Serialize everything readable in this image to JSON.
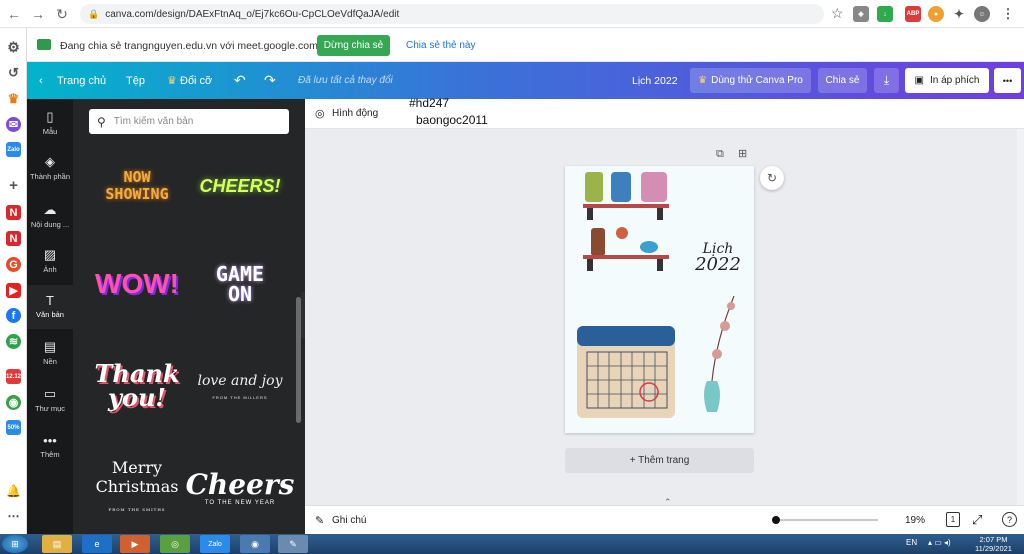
{
  "browser": {
    "url": "canva.com/design/DAExFtnAq_o/Ej7kc6Ou-CpCLOeVdfQaJA/edit",
    "extensions": [
      "star-icon",
      "shield-icon",
      "download-icon",
      "adblock-icon",
      "color-icon",
      "puzzle-icon",
      "profile-icon",
      "menu-icon"
    ]
  },
  "share_bar": {
    "message": "Đang chia sẻ trangnguyen.edu.vn với meet.google.com",
    "stop_label": "Dừng chia sẻ",
    "share_tab_label": "Chia sẻ thẻ này"
  },
  "topbar": {
    "home": "Trang chủ",
    "file": "Tệp",
    "resize": "Đổi cỡ",
    "saved": "Đã lưu tất cả thay đổi",
    "title": "Lịch 2022",
    "pro": "Dùng thử Canva Pro",
    "share": "Chia sẻ",
    "print": "In áp phích",
    "more": "•••"
  },
  "rail": [
    {
      "label": "Mẫu",
      "icon": "template-icon"
    },
    {
      "label": "Thành phần",
      "icon": "elements-icon"
    },
    {
      "label": "Nội dung ...",
      "icon": "upload-icon"
    },
    {
      "label": "Ảnh",
      "icon": "photo-icon"
    },
    {
      "label": "Văn bản",
      "icon": "text-icon"
    },
    {
      "label": "Nền",
      "icon": "background-icon"
    },
    {
      "label": "Thư mục",
      "icon": "folder-icon"
    },
    {
      "label": "Thêm",
      "icon": "more-icon"
    }
  ],
  "search": {
    "placeholder": "Tìm kiếm văn bản"
  },
  "text_tiles": [
    {
      "line1": "NOW",
      "line2": "SHOWING",
      "sub": ""
    },
    {
      "line1": "CHEERS!",
      "line2": "",
      "sub": ""
    },
    {
      "line1": "WOW!",
      "line2": "",
      "sub": ""
    },
    {
      "line1": "GAME",
      "line2": "ON",
      "sub": ""
    },
    {
      "line1": "Thank",
      "line2": "you!",
      "sub": ""
    },
    {
      "line1": "love and joy",
      "line2": "",
      "sub": "FROM THE MILLERS"
    },
    {
      "line1": "Merry",
      "line2": "Christmas",
      "sub": "FROM THE SMITHS"
    },
    {
      "line1": "Cheers",
      "line2": "",
      "sub": "TO THE NEW YEAR"
    }
  ],
  "context": {
    "animate": "Hình động",
    "overlay_line1": "#hd247",
    "overlay_line2": "baongoc2011"
  },
  "page": {
    "title_line1": "Lịch",
    "title_line2": "2022"
  },
  "add_page": "+ Thêm trang",
  "footer": {
    "notes": "Ghi chú",
    "zoom": "19%",
    "page_count": "1",
    "zoom_fraction": 0.19
  },
  "taskbar": {
    "lang": "EN",
    "time": "2:07 PM",
    "date": "11/29/2021"
  }
}
